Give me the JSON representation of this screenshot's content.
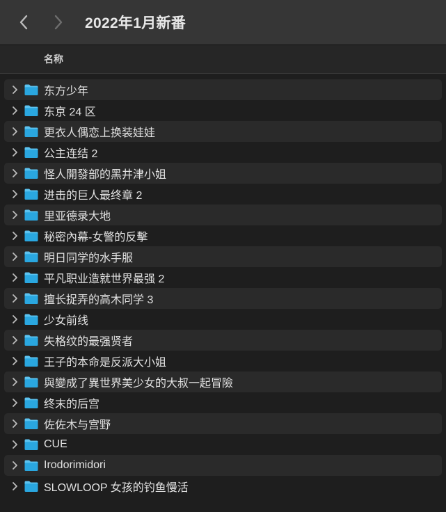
{
  "window": {
    "title": "2022年1月新番"
  },
  "columns": {
    "name": "名称"
  },
  "icons": {
    "back": "chevron-left-icon",
    "forward": "chevron-right-icon",
    "disclosure": "chevron-right-icon",
    "folder": "folder-icon"
  },
  "colors": {
    "folder": "#2aa7e0",
    "folder_tab": "#5cc3f0",
    "alt_row": "#2a2a2a",
    "titlebar": "#363636"
  },
  "items": [
    {
      "label": "东方少年"
    },
    {
      "label": "东京 24 区"
    },
    {
      "label": "更衣人偶恋上换装娃娃"
    },
    {
      "label": "公主连结 2"
    },
    {
      "label": "怪人開發部的黑井津小姐"
    },
    {
      "label": "进击的巨人最终章 2"
    },
    {
      "label": "里亚德录大地"
    },
    {
      "label": "秘密內幕-女警的反擊"
    },
    {
      "label": "明日同学的水手服"
    },
    {
      "label": "平凡职业造就世界最强 2"
    },
    {
      "label": "擅长捉弄的高木同学 3"
    },
    {
      "label": "少女前线"
    },
    {
      "label": "失格纹的最强贤者"
    },
    {
      "label": "王子的本命是反派大小姐"
    },
    {
      "label": "與變成了異世界美少女的大叔一起冒險"
    },
    {
      "label": "终末的后宫"
    },
    {
      "label": "佐佐木与宫野"
    },
    {
      "label": "CUE"
    },
    {
      "label": "Irodorimidori"
    },
    {
      "label": "SLOWLOOP 女孩的钓鱼慢活"
    }
  ]
}
